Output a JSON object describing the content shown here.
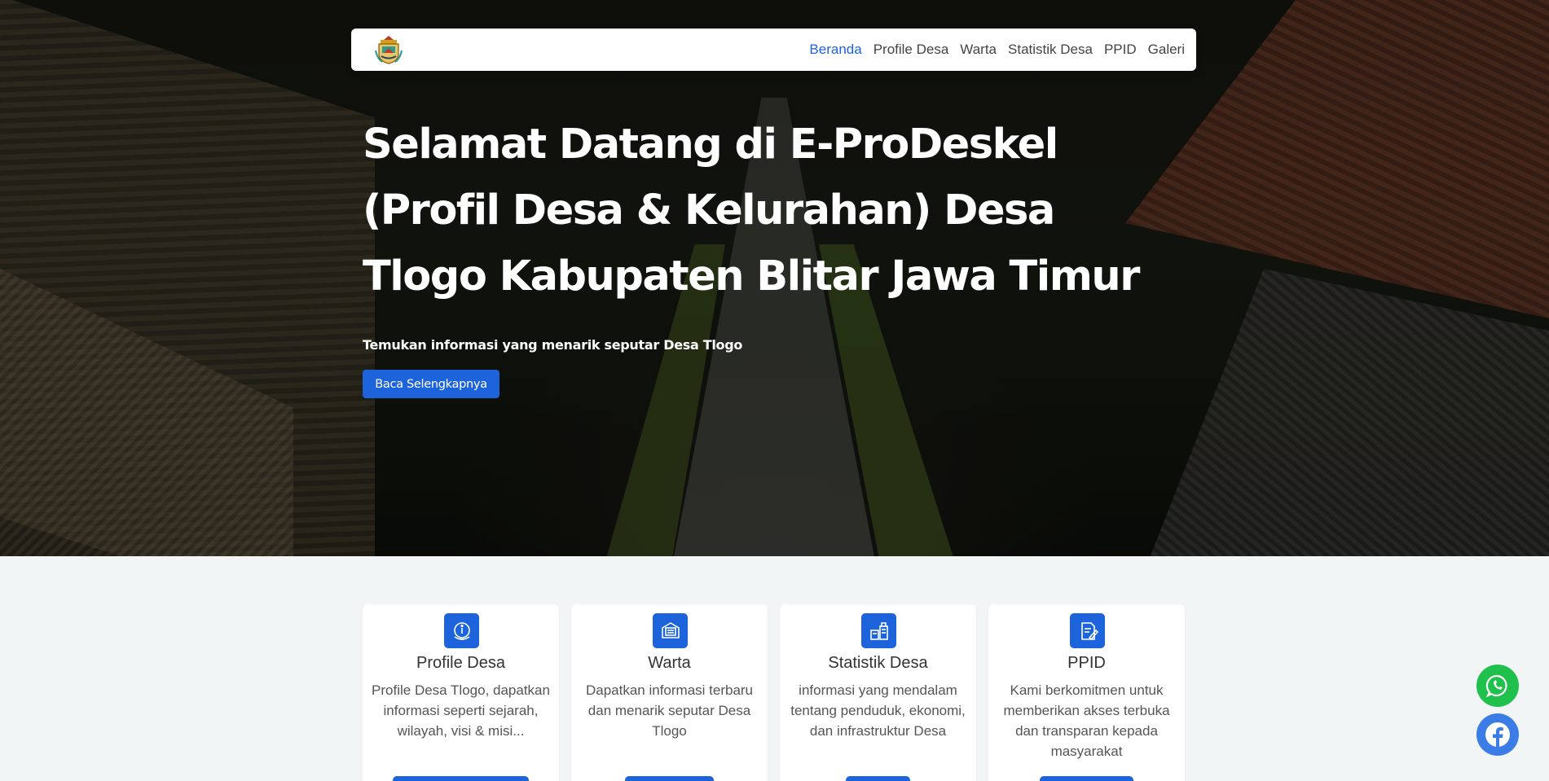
{
  "nav": {
    "logo": "village-crest-logo",
    "items": [
      {
        "label": "Beranda",
        "active": true
      },
      {
        "label": "Profile Desa",
        "active": false
      },
      {
        "label": "Warta",
        "active": false
      },
      {
        "label": "Statistik Desa",
        "active": false
      },
      {
        "label": "PPID",
        "active": false
      },
      {
        "label": "Galeri",
        "active": false
      }
    ]
  },
  "hero": {
    "title_line1": "Selamat Datang di E-ProDeskel",
    "title_line2": "(Profil Desa & Kelurahan) Desa",
    "title_line3": "Tlogo Kabupaten Blitar Jawa Timur",
    "subtitle": "Temukan informasi yang menarik seputar Desa Tlogo",
    "button": "Baca Selengkapnya"
  },
  "cards": [
    {
      "icon": "info-book-icon",
      "title": "Profile Desa",
      "text": "Profile Desa Tlogo, dapatkan informasi seperti sejarah, wilayah, visi & misi...",
      "button": ""
    },
    {
      "icon": "newspaper-icon",
      "title": "Warta",
      "text": "Dapatkan informasi terbaru dan menarik seputar Desa Tlogo",
      "button": ""
    },
    {
      "icon": "building-icon",
      "title": "Statistik Desa",
      "text": "informasi yang mendalam tentang penduduk, ekonomi, dan infrastruktur Desa",
      "button": ""
    },
    {
      "icon": "document-pen-icon",
      "title": "PPID",
      "text": "Kami berkomitmen untuk memberikan akses terbuka dan transparan kepada masyarakat",
      "button": ""
    }
  ],
  "floating": {
    "whatsapp": "whatsapp-icon",
    "facebook": "facebook-icon"
  },
  "colors": {
    "primary": "#1d63dc",
    "whatsapp": "#1fc04c",
    "facebook": "#3b7ce6",
    "section_bg": "#f2f5f6"
  }
}
